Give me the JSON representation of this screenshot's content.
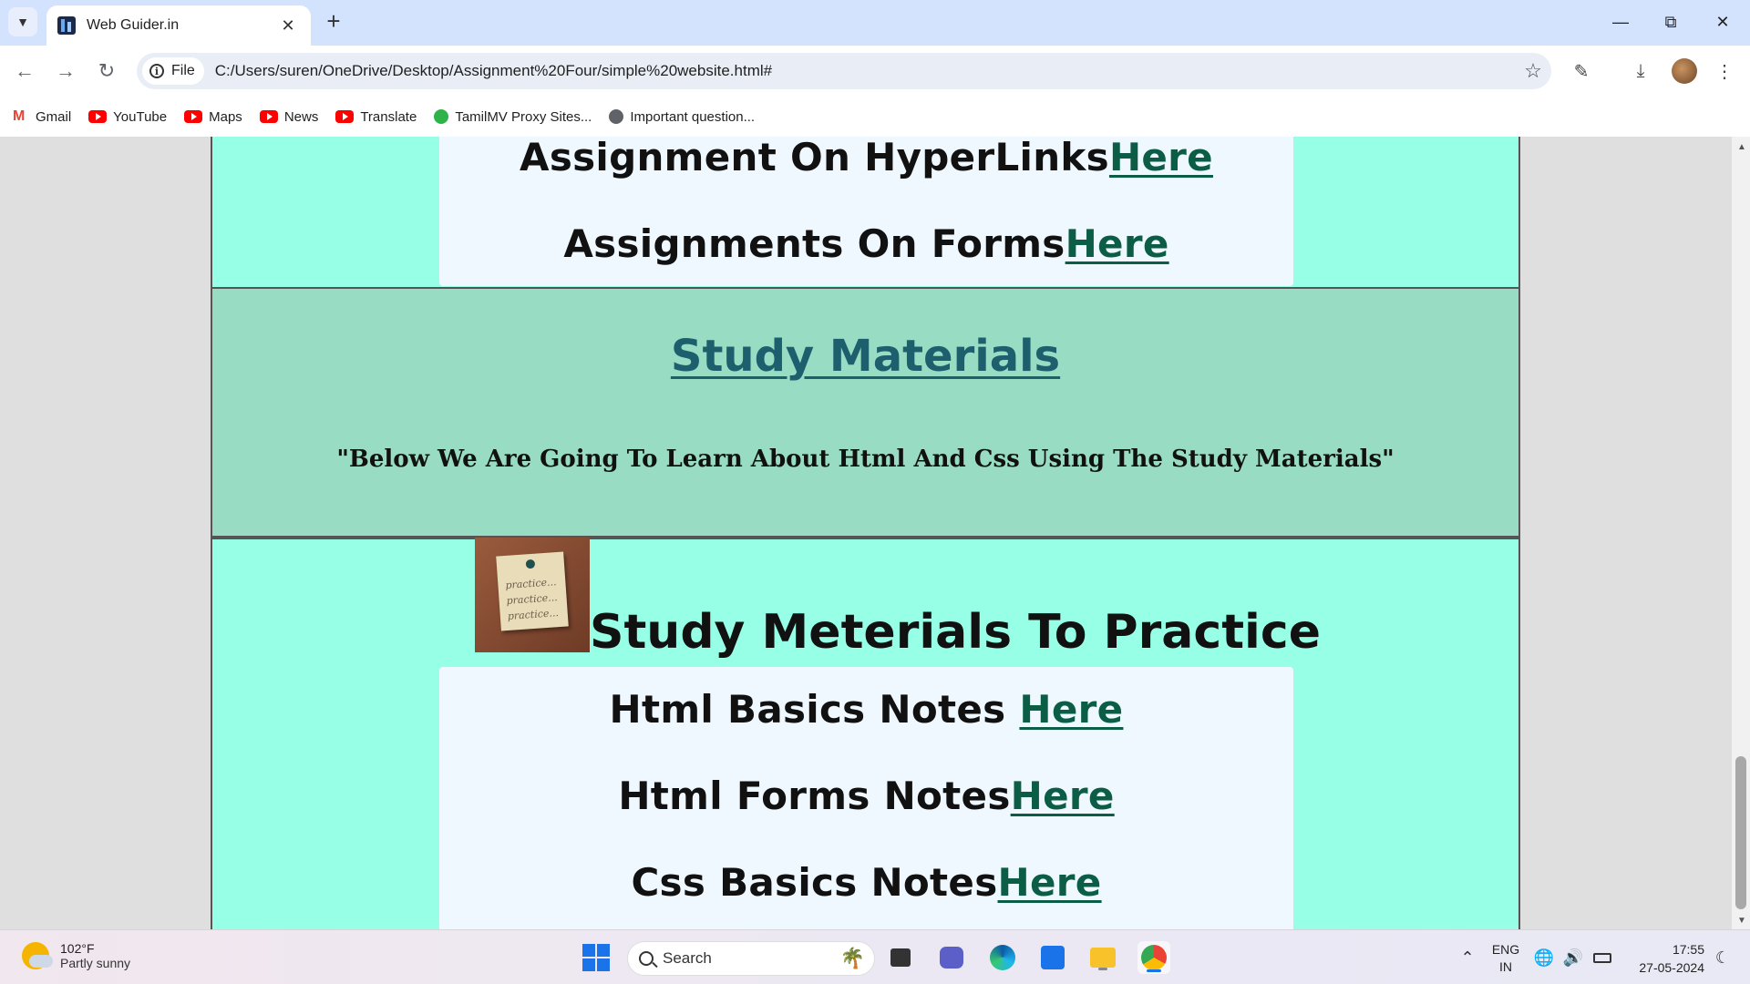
{
  "browser": {
    "tab_title": "Web Guider.in",
    "file_label": "File",
    "url": "C:/Users/suren/OneDrive/Desktop/Assignment%20Four/simple%20website.html#",
    "bookmarks": [
      {
        "label": "Gmail",
        "icon": "gmail-icon"
      },
      {
        "label": "YouTube",
        "icon": "youtube-icon"
      },
      {
        "label": "Maps",
        "icon": "youtube-icon"
      },
      {
        "label": "News",
        "icon": "youtube-icon"
      },
      {
        "label": "Translate",
        "icon": "youtube-icon"
      },
      {
        "label": "TamilMV Proxy Sites...",
        "icon": "tamilmv-icon"
      },
      {
        "label": "Important question...",
        "icon": "globe-icon"
      }
    ]
  },
  "page": {
    "assignments": {
      "hyperlinks_text": "Assignment On HyperLinks",
      "hyperlinks_link": "Here",
      "forms_text": "Assignments On Forms",
      "forms_link": "Here"
    },
    "study_materials": {
      "title": "Study Materials",
      "quote": "\"Below We Are Going To Learn About Html And Css Using The Study Materials\""
    },
    "practice": {
      "image_text": [
        "practice...",
        "practice...",
        "practice..."
      ],
      "title": "Study Meterials To Practice",
      "items": [
        {
          "text": "Html Basics Notes ",
          "link": "Here"
        },
        {
          "text": "Html Forms Notes",
          "link": "Here"
        },
        {
          "text": "Css Basics Notes",
          "link": "Here"
        }
      ]
    }
  },
  "taskbar": {
    "weather_temp": "102°F",
    "weather_desc": "Partly sunny",
    "search_placeholder": "Search",
    "lang_line1": "ENG",
    "lang_line2": "IN",
    "time": "17:55",
    "date": "27-05-2024"
  },
  "colors": {
    "panel_aqua": "#96ffe6",
    "panel_green": "#98dcc4",
    "link": "#0b5d46",
    "title_link": "#1e5f6e"
  }
}
